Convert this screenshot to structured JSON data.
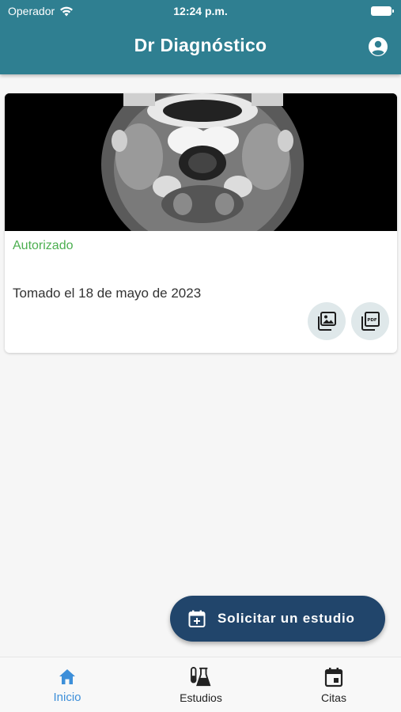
{
  "status_bar": {
    "carrier": "Operador",
    "time": "12:24 p.m."
  },
  "app_bar": {
    "title": "Dr Diagnóstico",
    "account_icon": "account-circle-icon"
  },
  "study_card": {
    "status": "Autorizado",
    "date": "Tomado el 18 de mayo de 2023",
    "actions": [
      {
        "icon": "image-gallery-icon"
      },
      {
        "icon": "pdf-icon"
      }
    ]
  },
  "fab": {
    "label": "Solicitar un estudio",
    "icon": "calendar-add-icon"
  },
  "bottom_nav": {
    "items": [
      {
        "label": "Inicio",
        "icon": "home-icon",
        "active": true
      },
      {
        "label": "Estudios",
        "icon": "flask-icon",
        "active": false
      },
      {
        "label": "Citas",
        "icon": "calendar-icon",
        "active": false
      }
    ]
  },
  "colors": {
    "app_bar": "#2f7f91",
    "status_authorized": "#4caf50",
    "fab": "#21456b",
    "nav_active": "#3d8fd9"
  }
}
